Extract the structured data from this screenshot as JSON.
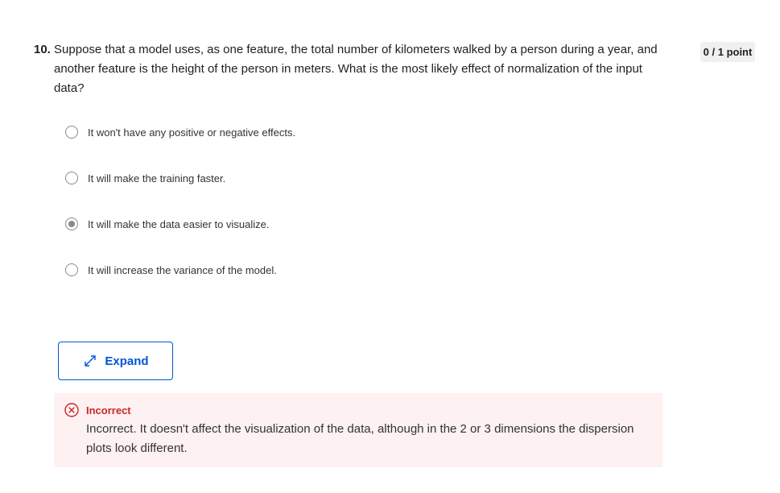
{
  "question": {
    "number": "10.",
    "text": "Suppose that a model uses, as one feature, the total number of kilometers walked by a person during a year, and another feature is the height of the person in meters. What is the most likely effect of normalization of the input data?"
  },
  "score": {
    "label": "0 / 1 point"
  },
  "options": [
    {
      "label": "It won't have any positive or negative effects.",
      "selected": false
    },
    {
      "label": "It will make the training faster.",
      "selected": false
    },
    {
      "label": "It will make the data easier to visualize.",
      "selected": true
    },
    {
      "label": "It will increase the variance of the model.",
      "selected": false
    }
  ],
  "expand_button": {
    "label": "Expand",
    "icon": "expand-arrows-icon"
  },
  "feedback": {
    "status": "Incorrect",
    "icon": "x-circle-icon",
    "message": "Incorrect. It doesn't affect the visualization of the data, although in the 2 or 3 dimensions the dispersion plots look different."
  },
  "colors": {
    "accent": "#0056d2",
    "error": "#c62828",
    "error_bg": "#fdf1f1",
    "badge_bg": "#f0f0f0"
  }
}
